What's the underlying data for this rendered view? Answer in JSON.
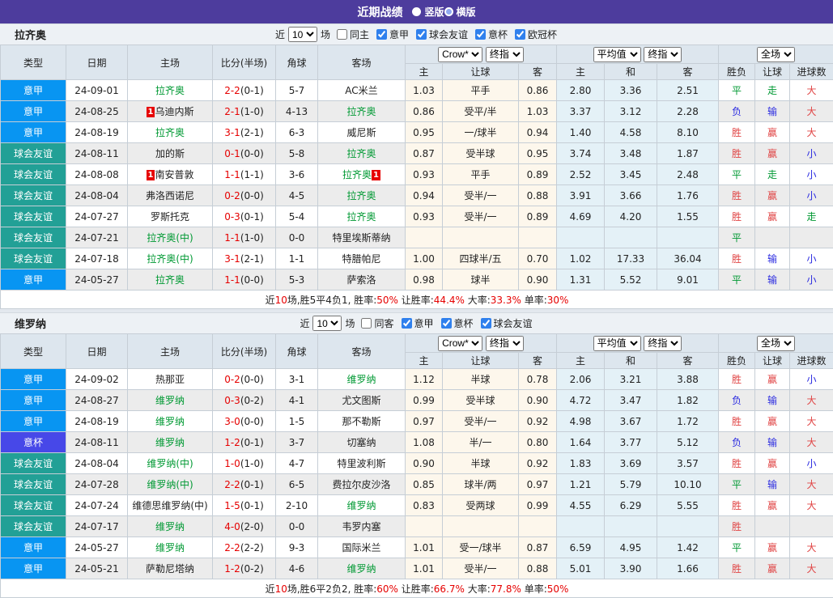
{
  "titlebar": {
    "title": "近期战绩",
    "radios": [
      {
        "label": "竖版",
        "selected": true
      },
      {
        "label": "横版",
        "selected": false
      }
    ]
  },
  "colors": {
    "titlebar_bg": "#4d3c9d",
    "header_bg": "#dde6ee",
    "league_serie_a": "#0895f2",
    "league_friendly": "#22a096",
    "league_coppa": "#4748e8",
    "focal_team_green": "#009933",
    "score_red": "#e60000",
    "result_red": "#e04444",
    "result_blue": "#2a2ae0",
    "result_green": "#009933",
    "crow_col_bg": "#fdf7ec",
    "avg_col_bg": "#e4f1f7"
  },
  "columns": {
    "main": [
      "类型",
      "日期",
      "主场",
      "比分(半场)",
      "角球",
      "客场"
    ],
    "odds_selects": [
      "Crow*",
      "终指"
    ],
    "avg_selects": [
      "平均值",
      "终指"
    ],
    "result_selects": [
      "全场"
    ],
    "sub": [
      "主",
      "让球",
      "客",
      "主",
      "和",
      "客",
      "胜负",
      "让球",
      "进球数"
    ]
  },
  "sections": [
    {
      "team": "拉齐奥",
      "filter": {
        "near": "近",
        "count": "10",
        "unit": "场",
        "same_venue": {
          "label": "同主",
          "checked": false
        },
        "leagues": [
          {
            "label": "意甲",
            "checked": true
          },
          {
            "label": "球会友谊",
            "checked": true
          },
          {
            "label": "意杯",
            "checked": true
          },
          {
            "label": "欧冠杯",
            "checked": true
          }
        ]
      },
      "rows": [
        {
          "league": "意甲",
          "lk": "a",
          "date": "24-09-01",
          "home": {
            "name": "拉齐奥",
            "focal": true
          },
          "score": "2-2",
          "half": "(0-1)",
          "corners": "5-7",
          "away": {
            "name": "AC米兰"
          },
          "odds": [
            "1.03",
            "平手",
            "0.86"
          ],
          "avg": [
            "2.80",
            "3.36",
            "2.51"
          ],
          "res": [
            [
              "平",
              "g"
            ],
            [
              "走",
              "g"
            ],
            [
              "大",
              "r"
            ]
          ]
        },
        {
          "league": "意甲",
          "lk": "a",
          "date": "24-08-25",
          "home": {
            "name": "乌迪内斯",
            "card": "1",
            "card_pos": "before"
          },
          "score": "2-1",
          "half": "(1-0)",
          "corners": "4-13",
          "away": {
            "name": "拉齐奥",
            "focal": true
          },
          "odds": [
            "0.86",
            "受平/半",
            "1.03"
          ],
          "avg": [
            "3.37",
            "3.12",
            "2.28"
          ],
          "res": [
            [
              "负",
              "b"
            ],
            [
              "输",
              "b"
            ],
            [
              "大",
              "r"
            ]
          ]
        },
        {
          "league": "意甲",
          "lk": "a",
          "date": "24-08-19",
          "home": {
            "name": "拉齐奥",
            "focal": true
          },
          "score": "3-1",
          "half": "(2-1)",
          "corners": "6-3",
          "away": {
            "name": "威尼斯"
          },
          "odds": [
            "0.95",
            "一/球半",
            "0.94"
          ],
          "avg": [
            "1.40",
            "4.58",
            "8.10"
          ],
          "res": [
            [
              "胜",
              "r"
            ],
            [
              "赢",
              "r"
            ],
            [
              "大",
              "r"
            ]
          ]
        },
        {
          "league": "球会友谊",
          "lk": "f",
          "date": "24-08-11",
          "home": {
            "name": "加的斯"
          },
          "score": "0-1",
          "half": "(0-0)",
          "corners": "5-8",
          "away": {
            "name": "拉齐奥",
            "focal": true
          },
          "odds": [
            "0.87",
            "受半球",
            "0.95"
          ],
          "avg": [
            "3.74",
            "3.48",
            "1.87"
          ],
          "res": [
            [
              "胜",
              "r"
            ],
            [
              "赢",
              "r"
            ],
            [
              "小",
              "b"
            ]
          ]
        },
        {
          "league": "球会友谊",
          "lk": "f",
          "date": "24-08-08",
          "home": {
            "name": "南安普敦",
            "card": "1",
            "card_pos": "before"
          },
          "score": "1-1",
          "half": "(1-1)",
          "corners": "3-6",
          "away": {
            "name": "拉齐奥",
            "focal": true,
            "card": "1",
            "card_pos": "after"
          },
          "odds": [
            "0.93",
            "平手",
            "0.89"
          ],
          "avg": [
            "2.52",
            "3.45",
            "2.48"
          ],
          "res": [
            [
              "平",
              "g"
            ],
            [
              "走",
              "g"
            ],
            [
              "小",
              "b"
            ]
          ]
        },
        {
          "league": "球会友谊",
          "lk": "f",
          "date": "24-08-04",
          "home": {
            "name": "弗洛西诺尼"
          },
          "score": "0-2",
          "half": "(0-0)",
          "corners": "4-5",
          "away": {
            "name": "拉齐奥",
            "focal": true
          },
          "odds": [
            "0.94",
            "受半/一",
            "0.88"
          ],
          "avg": [
            "3.91",
            "3.66",
            "1.76"
          ],
          "res": [
            [
              "胜",
              "r"
            ],
            [
              "赢",
              "r"
            ],
            [
              "小",
              "b"
            ]
          ]
        },
        {
          "league": "球会友谊",
          "lk": "f",
          "date": "24-07-27",
          "home": {
            "name": "罗斯托克"
          },
          "score": "0-3",
          "half": "(0-1)",
          "corners": "5-4",
          "away": {
            "name": "拉齐奥",
            "focal": true
          },
          "odds": [
            "0.93",
            "受半/一",
            "0.89"
          ],
          "avg": [
            "4.69",
            "4.20",
            "1.55"
          ],
          "res": [
            [
              "胜",
              "r"
            ],
            [
              "赢",
              "r"
            ],
            [
              "走",
              "g"
            ]
          ]
        },
        {
          "league": "球会友谊",
          "lk": "f",
          "date": "24-07-21",
          "home": {
            "name": "拉齐奥(中)",
            "focal": true
          },
          "score": "1-1",
          "half": "(1-0)",
          "corners": "0-0",
          "away": {
            "name": "特里埃斯蒂纳"
          },
          "odds": [
            "",
            "",
            ""
          ],
          "avg": [
            "",
            "",
            ""
          ],
          "res": [
            [
              "平",
              "g"
            ],
            [
              "",
              ""
            ],
            [
              "",
              ""
            ]
          ]
        },
        {
          "league": "球会友谊",
          "lk": "f",
          "date": "24-07-18",
          "home": {
            "name": "拉齐奥(中)",
            "focal": true
          },
          "score": "3-1",
          "half": "(2-1)",
          "corners": "1-1",
          "away": {
            "name": "特腊帕尼"
          },
          "odds": [
            "1.00",
            "四球半/五",
            "0.70"
          ],
          "avg": [
            "1.02",
            "17.33",
            "36.04"
          ],
          "res": [
            [
              "胜",
              "r"
            ],
            [
              "输",
              "b"
            ],
            [
              "小",
              "b"
            ]
          ]
        },
        {
          "league": "意甲",
          "lk": "a",
          "date": "24-05-27",
          "home": {
            "name": "拉齐奥",
            "focal": true
          },
          "score": "1-1",
          "half": "(0-0)",
          "corners": "5-3",
          "away": {
            "name": "萨索洛"
          },
          "odds": [
            "0.98",
            "球半",
            "0.90"
          ],
          "avg": [
            "1.31",
            "5.52",
            "9.01"
          ],
          "res": [
            [
              "平",
              "g"
            ],
            [
              "输",
              "b"
            ],
            [
              "小",
              "b"
            ]
          ]
        }
      ],
      "summary": [
        {
          "t": "近"
        },
        {
          "t": "10",
          "red": true
        },
        {
          "t": "场,胜5平4负1, 胜率:"
        },
        {
          "t": "50%",
          "red": true
        },
        {
          "t": " 让胜率:"
        },
        {
          "t": "44.4%",
          "red": true
        },
        {
          "t": " 大率:"
        },
        {
          "t": "33.3%",
          "red": true
        },
        {
          "t": " 单率:"
        },
        {
          "t": "30%",
          "red": true
        }
      ]
    },
    {
      "team": "维罗纳",
      "filter": {
        "near": "近",
        "count": "10",
        "unit": "场",
        "same_venue": {
          "label": "同客",
          "checked": false
        },
        "leagues": [
          {
            "label": "意甲",
            "checked": true
          },
          {
            "label": "意杯",
            "checked": true
          },
          {
            "label": "球会友谊",
            "checked": true
          }
        ]
      },
      "rows": [
        {
          "league": "意甲",
          "lk": "a",
          "date": "24-09-02",
          "home": {
            "name": "热那亚"
          },
          "score": "0-2",
          "half": "(0-0)",
          "corners": "3-1",
          "away": {
            "name": "维罗纳",
            "focal": true
          },
          "odds": [
            "1.12",
            "半球",
            "0.78"
          ],
          "avg": [
            "2.06",
            "3.21",
            "3.88"
          ],
          "res": [
            [
              "胜",
              "r"
            ],
            [
              "赢",
              "r"
            ],
            [
              "小",
              "b"
            ]
          ]
        },
        {
          "league": "意甲",
          "lk": "a",
          "date": "24-08-27",
          "home": {
            "name": "维罗纳",
            "focal": true
          },
          "score": "0-3",
          "half": "(0-2)",
          "corners": "4-1",
          "away": {
            "name": "尤文图斯"
          },
          "odds": [
            "0.99",
            "受半球",
            "0.90"
          ],
          "avg": [
            "4.72",
            "3.47",
            "1.82"
          ],
          "res": [
            [
              "负",
              "b"
            ],
            [
              "输",
              "b"
            ],
            [
              "大",
              "r"
            ]
          ]
        },
        {
          "league": "意甲",
          "lk": "a",
          "date": "24-08-19",
          "home": {
            "name": "维罗纳",
            "focal": true
          },
          "score": "3-0",
          "half": "(0-0)",
          "corners": "1-5",
          "away": {
            "name": "那不勒斯"
          },
          "odds": [
            "0.97",
            "受半/一",
            "0.92"
          ],
          "avg": [
            "4.98",
            "3.67",
            "1.72"
          ],
          "res": [
            [
              "胜",
              "r"
            ],
            [
              "赢",
              "r"
            ],
            [
              "大",
              "r"
            ]
          ]
        },
        {
          "league": "意杯",
          "lk": "c",
          "date": "24-08-11",
          "home": {
            "name": "维罗纳",
            "focal": true
          },
          "score": "1-2",
          "half": "(0-1)",
          "corners": "3-7",
          "away": {
            "name": "切塞纳"
          },
          "odds": [
            "1.08",
            "半/一",
            "0.80"
          ],
          "avg": [
            "1.64",
            "3.77",
            "5.12"
          ],
          "res": [
            [
              "负",
              "b"
            ],
            [
              "输",
              "b"
            ],
            [
              "大",
              "r"
            ]
          ]
        },
        {
          "league": "球会友谊",
          "lk": "f",
          "date": "24-08-04",
          "home": {
            "name": "维罗纳(中)",
            "focal": true
          },
          "score": "1-0",
          "half": "(1-0)",
          "corners": "4-7",
          "away": {
            "name": "特里波利斯"
          },
          "odds": [
            "0.90",
            "半球",
            "0.92"
          ],
          "avg": [
            "1.83",
            "3.69",
            "3.57"
          ],
          "res": [
            [
              "胜",
              "r"
            ],
            [
              "赢",
              "r"
            ],
            [
              "小",
              "b"
            ]
          ]
        },
        {
          "league": "球会友谊",
          "lk": "f",
          "date": "24-07-28",
          "home": {
            "name": "维罗纳(中)",
            "focal": true
          },
          "score": "2-2",
          "half": "(0-1)",
          "corners": "6-5",
          "away": {
            "name": "费拉尔皮沙洛"
          },
          "odds": [
            "0.85",
            "球半/两",
            "0.97"
          ],
          "avg": [
            "1.21",
            "5.79",
            "10.10"
          ],
          "res": [
            [
              "平",
              "g"
            ],
            [
              "输",
              "b"
            ],
            [
              "大",
              "r"
            ]
          ]
        },
        {
          "league": "球会友谊",
          "lk": "f",
          "date": "24-07-24",
          "home": {
            "name": "维德思维罗纳(中)"
          },
          "score": "1-5",
          "half": "(0-1)",
          "corners": "2-10",
          "away": {
            "name": "维罗纳",
            "focal": true
          },
          "odds": [
            "0.83",
            "受两球",
            "0.99"
          ],
          "avg": [
            "4.55",
            "6.29",
            "5.55"
          ],
          "res": [
            [
              "胜",
              "r"
            ],
            [
              "赢",
              "r"
            ],
            [
              "大",
              "r"
            ]
          ]
        },
        {
          "league": "球会友谊",
          "lk": "f",
          "date": "24-07-17",
          "home": {
            "name": "维罗纳",
            "focal": true
          },
          "score": "4-0",
          "half": "(2-0)",
          "corners": "0-0",
          "away": {
            "name": "韦罗内塞"
          },
          "odds": [
            "",
            "",
            ""
          ],
          "avg": [
            "",
            "",
            ""
          ],
          "res": [
            [
              "胜",
              "r"
            ],
            [
              "",
              ""
            ],
            [
              "",
              ""
            ]
          ]
        },
        {
          "league": "意甲",
          "lk": "a",
          "date": "24-05-27",
          "home": {
            "name": "维罗纳",
            "focal": true
          },
          "score": "2-2",
          "half": "(2-2)",
          "corners": "9-3",
          "away": {
            "name": "国际米兰"
          },
          "odds": [
            "1.01",
            "受一/球半",
            "0.87"
          ],
          "avg": [
            "6.59",
            "4.95",
            "1.42"
          ],
          "res": [
            [
              "平",
              "g"
            ],
            [
              "赢",
              "r"
            ],
            [
              "大",
              "r"
            ]
          ]
        },
        {
          "league": "意甲",
          "lk": "a",
          "date": "24-05-21",
          "home": {
            "name": "萨勒尼塔纳"
          },
          "score": "1-2",
          "half": "(0-2)",
          "corners": "4-6",
          "away": {
            "name": "维罗纳",
            "focal": true
          },
          "odds": [
            "1.01",
            "受半/一",
            "0.88"
          ],
          "avg": [
            "5.01",
            "3.90",
            "1.66"
          ],
          "res": [
            [
              "胜",
              "r"
            ],
            [
              "赢",
              "r"
            ],
            [
              "大",
              "r"
            ]
          ]
        }
      ],
      "summary": [
        {
          "t": "近"
        },
        {
          "t": "10",
          "red": true
        },
        {
          "t": "场,胜6平2负2, 胜率:"
        },
        {
          "t": "60%",
          "red": true
        },
        {
          "t": " 让胜率:"
        },
        {
          "t": "66.7%",
          "red": true
        },
        {
          "t": " 大率:"
        },
        {
          "t": "77.8%",
          "red": true
        },
        {
          "t": " 单率:"
        },
        {
          "t": "50%",
          "red": true
        }
      ]
    }
  ]
}
